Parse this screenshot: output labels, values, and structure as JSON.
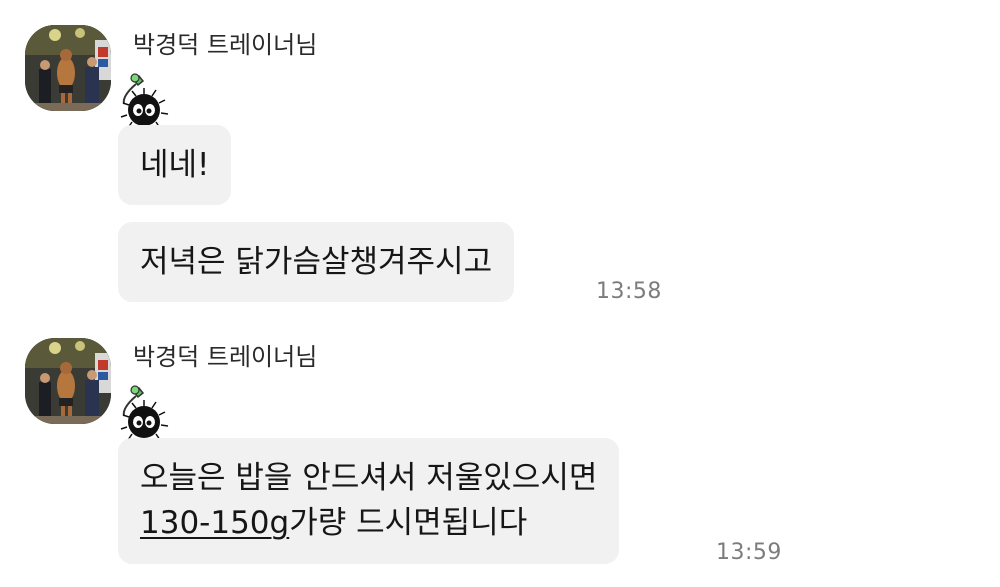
{
  "messages": [
    {
      "sender": "박경덕 트레이너님",
      "bubbles": [
        "네네!",
        "저녁은 닭가슴살챙겨주시고"
      ],
      "time": "13:58"
    },
    {
      "sender": "박경덕 트레이너님",
      "bubbles": [
        {
          "line1": "오늘은 밥을 안드셔서 저울있으시면",
          "line2_link": "130-150g",
          "line2_rest": "가량 드시면됩니다"
        }
      ],
      "time": "13:59"
    }
  ],
  "colors": {
    "bubble": "#f1f1f1",
    "time": "#7c7c7c",
    "sticker_leaf": "#5cc45c"
  }
}
